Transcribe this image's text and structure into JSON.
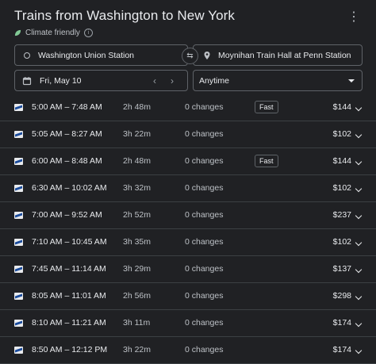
{
  "header": {
    "title": "Trains from Washington to New York",
    "subtitle": "Climate friendly"
  },
  "search": {
    "origin": "Washington Union Station",
    "destination": "Moynihan Train Hall at Penn Station",
    "date": "Fri, May 10",
    "time": "Anytime"
  },
  "trips": [
    {
      "time": "5:00 AM – 7:48 AM",
      "duration": "2h 48m",
      "changes": "0 changes",
      "badge": "Fast",
      "price": "$144"
    },
    {
      "time": "5:05 AM – 8:27 AM",
      "duration": "3h 22m",
      "changes": "0 changes",
      "badge": "",
      "price": "$102"
    },
    {
      "time": "6:00 AM – 8:48 AM",
      "duration": "2h 48m",
      "changes": "0 changes",
      "badge": "Fast",
      "price": "$144"
    },
    {
      "time": "6:30 AM – 10:02 AM",
      "duration": "3h 32m",
      "changes": "0 changes",
      "badge": "",
      "price": "$102"
    },
    {
      "time": "7:00 AM – 9:52 AM",
      "duration": "2h 52m",
      "changes": "0 changes",
      "badge": "",
      "price": "$237"
    },
    {
      "time": "7:10 AM – 10:45 AM",
      "duration": "3h 35m",
      "changes": "0 changes",
      "badge": "",
      "price": "$102"
    },
    {
      "time": "7:45 AM – 11:14 AM",
      "duration": "3h 29m",
      "changes": "0 changes",
      "badge": "",
      "price": "$137"
    },
    {
      "time": "8:05 AM – 11:01 AM",
      "duration": "2h 56m",
      "changes": "0 changes",
      "badge": "",
      "price": "$298"
    },
    {
      "time": "8:10 AM – 11:21 AM",
      "duration": "3h 11m",
      "changes": "0 changes",
      "badge": "",
      "price": "$174"
    },
    {
      "time": "8:50 AM – 12:12 PM",
      "duration": "3h 22m",
      "changes": "0 changes",
      "badge": "",
      "price": "$174"
    }
  ]
}
